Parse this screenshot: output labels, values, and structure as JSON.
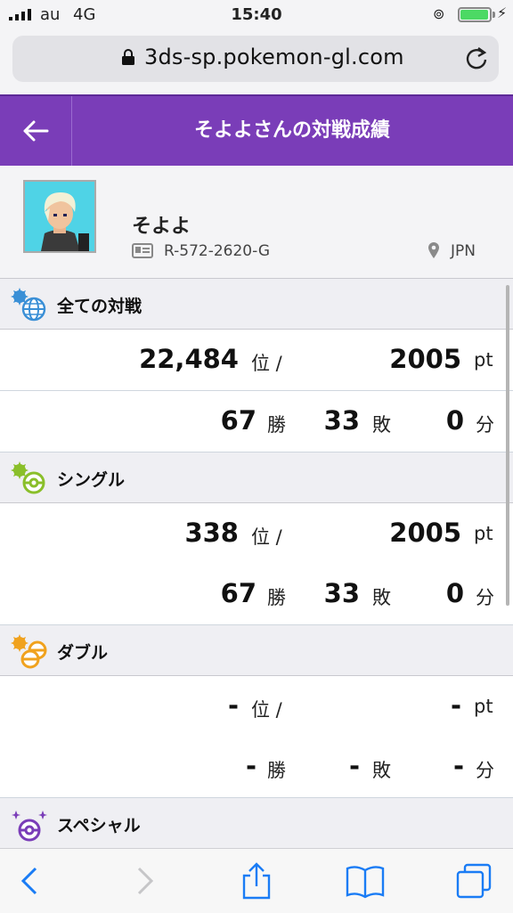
{
  "status": {
    "carrier": "au",
    "network": "4G",
    "time": "15:40"
  },
  "browser": {
    "url": "3ds-sp.pokemon-gl.com"
  },
  "header": {
    "title": "そよよさんの対戦成績"
  },
  "profile": {
    "name": "そよよ",
    "id": "R-572-2620-G",
    "country": "JPN"
  },
  "sections": {
    "all": {
      "label": "全ての対戦",
      "rank": "22,484",
      "rank_unit": "位 /",
      "points": "2005",
      "points_unit": "pt",
      "wins": "67",
      "wins_unit": "勝",
      "losses": "33",
      "losses_unit": "敗",
      "draws": "0",
      "draws_unit": "分"
    },
    "single": {
      "label": "シングル",
      "rank": "338",
      "rank_unit": "位 /",
      "points": "2005",
      "points_unit": "pt",
      "wins": "67",
      "wins_unit": "勝",
      "losses": "33",
      "losses_unit": "敗",
      "draws": "0",
      "draws_unit": "分"
    },
    "double": {
      "label": "ダブル",
      "rank": "-",
      "rank_unit": "位 /",
      "points": "-",
      "points_unit": "pt",
      "wins": "-",
      "wins_unit": "勝",
      "losses": "-",
      "losses_unit": "敗",
      "draws": "-",
      "draws_unit": "分"
    },
    "special": {
      "label": "スペシャル"
    }
  },
  "colors": {
    "header": "#7a3db8",
    "all_icon": "#3a8fd6",
    "single_icon": "#8abf2a",
    "double_icon": "#f0a21e",
    "special_icon": "#7a3db8",
    "safari_blue": "#1a7cf5"
  },
  "icons": {
    "back": "arrow-left-icon",
    "lock": "lock-icon",
    "reload": "reload-icon",
    "trainer_card": "id-card-icon",
    "location": "location-pin-icon",
    "all": "globe-icon",
    "single": "single-battle-icon",
    "double": "double-battle-icon",
    "special": "special-battle-icon",
    "toolbar": [
      "chevron-left-icon",
      "chevron-right-icon",
      "share-icon",
      "bookmarks-icon",
      "tabs-icon"
    ]
  }
}
